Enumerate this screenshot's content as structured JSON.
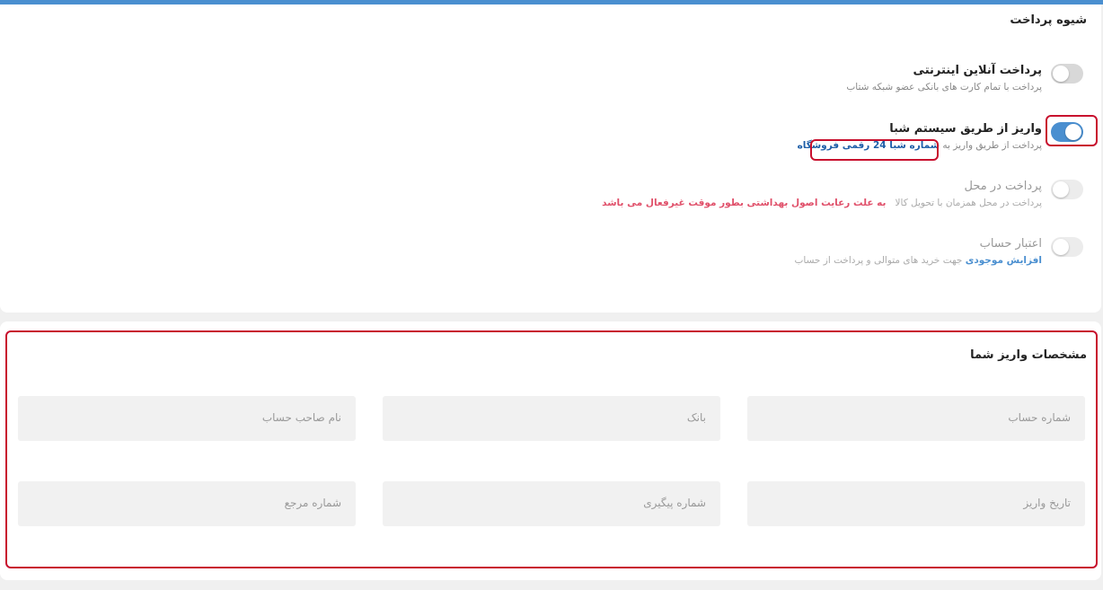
{
  "payment": {
    "title": "شیوه پرداخت",
    "options": [
      {
        "title": "پرداخت آنلاین اینترنتی",
        "desc": "پرداخت با تمام کارت های بانکی عضو شبکه شتاب",
        "enabled": false,
        "disabled": false
      },
      {
        "title": "واریز از طریق سیستم شبا",
        "desc": "پرداخت از طریق واریز به",
        "link": "شماره شبا 24 رقمی فروشگاه",
        "enabled": true,
        "disabled": false
      },
      {
        "title": "پرداخت در محل",
        "desc": "پرداخت در محل همزمان با تحویل کالا",
        "warning": "به علت رعایت اصول بهداشتی بطور موقت غیرفعال می باشد",
        "enabled": false,
        "disabled": true
      },
      {
        "title": "اعتبار حساب",
        "link": "افزایش موجودی",
        "desc": "جهت خرید های متوالی و پرداخت از حساب",
        "enabled": false,
        "disabled": true
      }
    ]
  },
  "deposit": {
    "title": "مشخصات واریز شما",
    "fields": {
      "account_number": "شماره حساب",
      "bank": "بانک",
      "account_holder": "نام صاحب حساب",
      "deposit_date": "تاریخ واریز",
      "tracking_number": "شماره پیگیری",
      "reference_number": "شماره مرجع"
    }
  },
  "colors": {
    "accent": "#4a8fd0",
    "highlight": "#c8102e",
    "warning": "#e0506a"
  }
}
